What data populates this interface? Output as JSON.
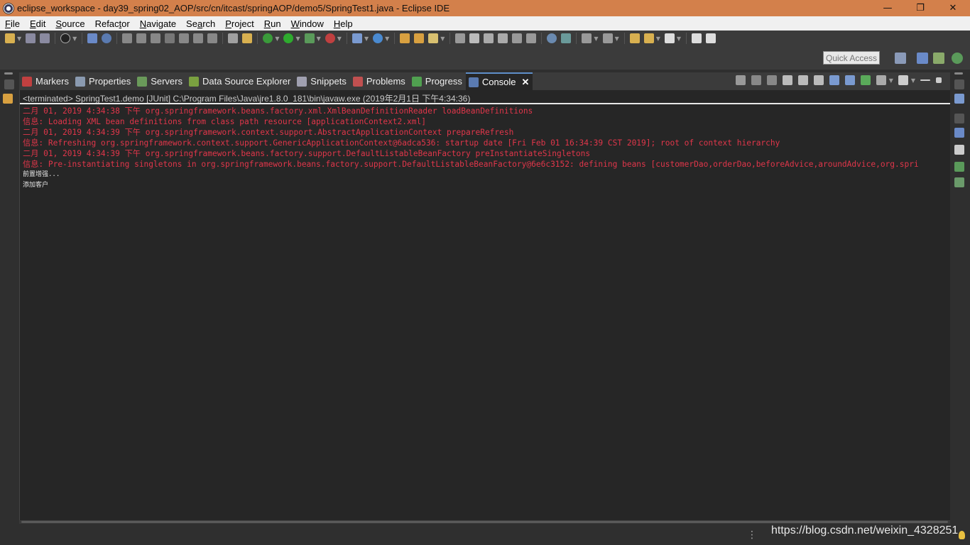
{
  "window": {
    "title": "eclipse_workspace - day39_spring02_AOP/src/cn/itcast/springAOP/demo5/SpringTest1.java - Eclipse IDE",
    "minimize": "—",
    "maximize": "❐",
    "close": "✕"
  },
  "menubar": {
    "items": [
      {
        "key": "F",
        "rest": "ile"
      },
      {
        "key": "E",
        "rest": "dit"
      },
      {
        "key": "S",
        "rest": "ource"
      },
      {
        "key": "",
        "rest": "Refac",
        "key2": "t",
        "rest2": "or"
      },
      {
        "key": "N",
        "rest": "avigate"
      },
      {
        "key": "",
        "rest": "Se",
        "key2": "a",
        "rest2": "rch"
      },
      {
        "key": "P",
        "rest": "roject"
      },
      {
        "key": "R",
        "rest": "un"
      },
      {
        "key": "W",
        "rest": "indow"
      },
      {
        "key": "H",
        "rest": "elp"
      }
    ]
  },
  "quick_access": {
    "placeholder": "Quick Access"
  },
  "tabs": [
    {
      "label": "Markers",
      "icon": "markers-icon",
      "color": "#c04040"
    },
    {
      "label": "Properties",
      "icon": "properties-icon",
      "color": "#8a9ab0"
    },
    {
      "label": "Servers",
      "icon": "servers-icon",
      "color": "#6a9a5a"
    },
    {
      "label": "Data Source Explorer",
      "icon": "data-source-icon",
      "color": "#7aa040"
    },
    {
      "label": "Snippets",
      "icon": "snippets-icon",
      "color": "#a0a0b0"
    },
    {
      "label": "Problems",
      "icon": "problems-icon",
      "color": "#c05050"
    },
    {
      "label": "Progress",
      "icon": "progress-icon",
      "color": "#50a050"
    },
    {
      "label": "Console",
      "icon": "console-icon",
      "color": "#5a7ab0",
      "active": true,
      "close": "✕"
    }
  ],
  "console": {
    "header": "<terminated> SpringTest1.demo [JUnit] C:\\Program Files\\Java\\jre1.8.0_181\\bin\\javaw.exe (2019年2月1日 下午4:34:36)",
    "lines": [
      {
        "kind": "err",
        "text": "二月 01, 2019 4:34:38 下午 org.springframework.beans.factory.xml.XmlBeanDefinitionReader loadBeanDefinitions"
      },
      {
        "kind": "err",
        "text": "信息: Loading XML bean definitions from class path resource [applicationContext2.xml]"
      },
      {
        "kind": "err",
        "text": "二月 01, 2019 4:34:39 下午 org.springframework.context.support.AbstractApplicationContext prepareRefresh"
      },
      {
        "kind": "err",
        "text": "信息: Refreshing org.springframework.context.support.GenericApplicationContext@6adca536: startup date [Fri Feb 01 16:34:39 CST 2019]; root of context hierarchy"
      },
      {
        "kind": "err",
        "text": "二月 01, 2019 4:34:39 下午 org.springframework.beans.factory.support.DefaultListableBeanFactory preInstantiateSingletons"
      },
      {
        "kind": "err",
        "text": "信息: Pre-instantiating singletons in org.springframework.beans.factory.support.DefaultListableBeanFactory@6e6c3152: defining beans [customerDao,orderDao,beforeAdvice,aroundAdvice,org.spri"
      },
      {
        "kind": "out",
        "text": "前置增强..."
      },
      {
        "kind": "out",
        "text": "添加客户"
      }
    ]
  },
  "statusbar": {
    "dots": "⋮"
  },
  "watermark": "https://blog.csdn.net/weixin_4328251"
}
